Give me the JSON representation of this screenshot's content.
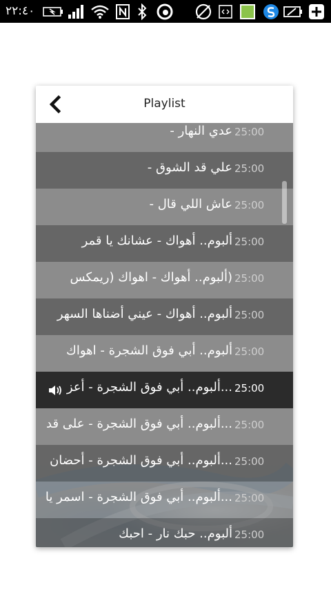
{
  "status_bar": {
    "time": "٢٢:٤٠",
    "icons": [
      "battery-icon",
      "signal-icon",
      "wifi-icon",
      "nfc-icon",
      "bluetooth-icon",
      "beats-icon",
      "no-camera-icon",
      "screen-icon",
      "sim-badge-icon",
      "s-note-icon",
      "battery-edit-icon",
      "add-icon"
    ],
    "sim_badge": "1"
  },
  "dialog": {
    "title": "Playlist"
  },
  "playlist": [
    {
      "title": "عدي النهار -",
      "duration": "25:00",
      "style": "light"
    },
    {
      "title": "علي قد الشوق -",
      "duration": "25:00",
      "style": "dark"
    },
    {
      "title": "عاش اللي قال -",
      "duration": "25:00",
      "style": "light"
    },
    {
      "title": "ألبوم.. أهواك - عشانك يا قمر",
      "duration": "25:00",
      "style": "dark"
    },
    {
      "title": "(ألبوم.. أهواك - اهواك (ريمكس",
      "duration": "25:00",
      "style": "light"
    },
    {
      "title": "ألبوم.. أهواك - عيني أضناها السهر",
      "duration": "25:00",
      "style": "dark"
    },
    {
      "title": "ألبوم.. أبي فوق الشجرة - اهواك",
      "duration": "25:00",
      "style": "light"
    },
    {
      "title": "...ألبوم.. أبي فوق الشجرة - أعز",
      "duration": "25:00",
      "style": "active"
    },
    {
      "title": "...ألبوم.. أبي فوق الشجرة - على قد",
      "duration": "25:00",
      "style": "light"
    },
    {
      "title": "...ألبوم.. أبي فوق الشجرة - أحضان",
      "duration": "25:00",
      "style": "dark"
    },
    {
      "title": "...ألبوم.. أبي فوق الشجرة - اسمر يا",
      "duration": "25:00",
      "style": "light"
    },
    {
      "title": "ألبوم.. حبك نار - احبك",
      "duration": "25:00",
      "style": "dark"
    }
  ],
  "colors": {
    "active_row": "#2b2b2b",
    "dark_row": "#5f5f5f",
    "light_row": "#8c8c8c"
  }
}
